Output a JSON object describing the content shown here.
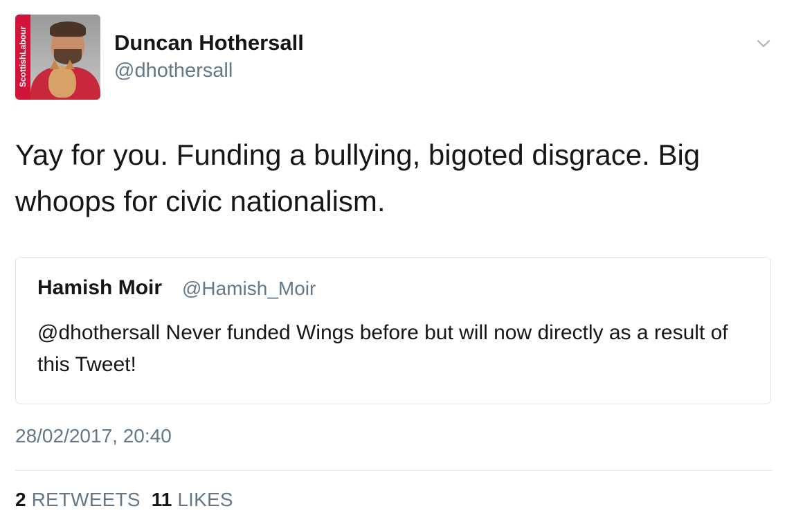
{
  "author": {
    "name": "Duncan Hothersall",
    "handle": "@dhothersall",
    "avatar_brand_text": "ScottishLabour"
  },
  "tweet": {
    "text": "Yay for you. Funding a bullying, bigoted disgrace. Big\nwhoops for civic nationalism."
  },
  "quoted_tweet": {
    "name": "Hamish Moir",
    "handle": "@Hamish_Moir",
    "text": "@dhothersall Never funded Wings before but will now directly as a result of this Tweet!"
  },
  "meta": {
    "timestamp": "28/02/2017, 20:40"
  },
  "stats": {
    "retweets_count": "2",
    "retweets_label": "RETWEETS",
    "likes_count": "11",
    "likes_label": "LIKES"
  },
  "icons": {
    "menu": "chevron-down-icon"
  },
  "colors": {
    "text_primary": "#14171a",
    "text_secondary": "#657786",
    "border": "#dfe3e8",
    "brand_red": "#d3143a"
  }
}
